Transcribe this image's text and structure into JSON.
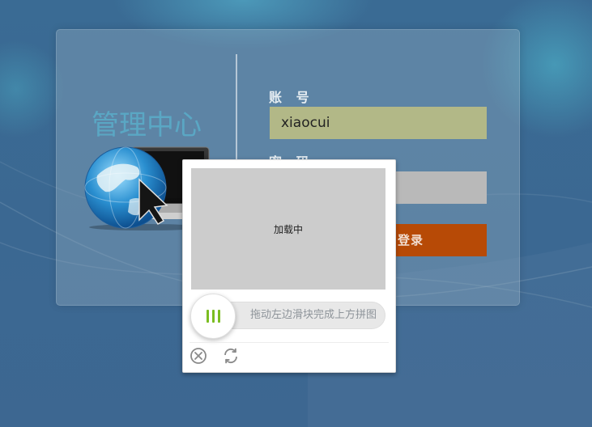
{
  "brand": {
    "title": "管理中心",
    "logo_icon": "globe-monitor-cursor-icon"
  },
  "login": {
    "account_label": "账 号",
    "account_value": "xiaocui",
    "password_label": "密 码",
    "password_value": "",
    "login_button_label": "登录"
  },
  "captcha": {
    "loading_text": "加载中",
    "slider_hint": "拖动左边滑块完成上方拼图",
    "handle_icon": "grip-lines-icon",
    "close_icon": "close-circle-icon",
    "refresh_icon": "refresh-icon"
  },
  "colors": {
    "background": "#3b6892",
    "account_input_bg": "#b2b887",
    "password_input_bg": "#b9b9b9",
    "login_button_bg": "#b74a06",
    "brand_title": "#5aa7c4",
    "grip_green": "#7bbd21",
    "captcha_placeholder": "#cccccc"
  }
}
